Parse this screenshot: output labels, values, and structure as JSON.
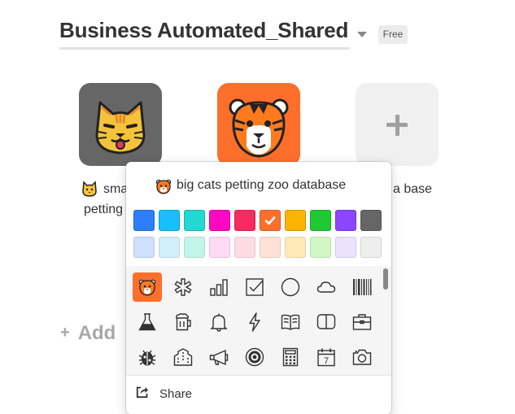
{
  "workspace": {
    "title": "Business Automated_Shared",
    "plan_badge": "Free"
  },
  "bases": [
    {
      "name_line1": "sma",
      "name_line2": "petting",
      "color": "#666666",
      "icon": "cat-face-icon"
    },
    {
      "name": "big cats petting zoo database",
      "color": "#ff6f2c",
      "icon": "tiger-face-icon"
    },
    {
      "name_fragment": "a base",
      "icon": "plus-icon"
    }
  ],
  "add_workspace": {
    "label": "Add"
  },
  "popup": {
    "base_name": "big cats petting zoo database",
    "colors_bright": [
      "#2d7ff9",
      "#18bfff",
      "#20d9d2",
      "#ff08c2",
      "#f82b60",
      "#ff6f2c",
      "#fcb400",
      "#20c933",
      "#8b46ff",
      "#666666"
    ],
    "colors_light": [
      "#cfdfff",
      "#d0f0fd",
      "#c2f5e9",
      "#ffdaf6",
      "#ffdce5",
      "#fee2d5",
      "#ffeab6",
      "#d1f7c4",
      "#ede2fe",
      "#eeeeee"
    ],
    "selected_color": "#ff6f2c",
    "icons": [
      [
        "tiger-face-icon",
        "asterisk-medical-icon",
        "bar-chart-icon",
        "checkbox-icon",
        "circle-icon",
        "cloud-icon",
        "barcode-icon"
      ],
      [
        "flask-icon",
        "beer-mug-icon",
        "bell-icon",
        "lightning-icon",
        "open-book-icon",
        "book-icon",
        "briefcase-icon"
      ],
      [
        "bug-icon",
        "building-icon",
        "megaphone-icon",
        "target-icon",
        "calculator-icon",
        "calendar-icon",
        "camera-icon"
      ]
    ],
    "calendar_day": "7",
    "share_label": "Share"
  }
}
